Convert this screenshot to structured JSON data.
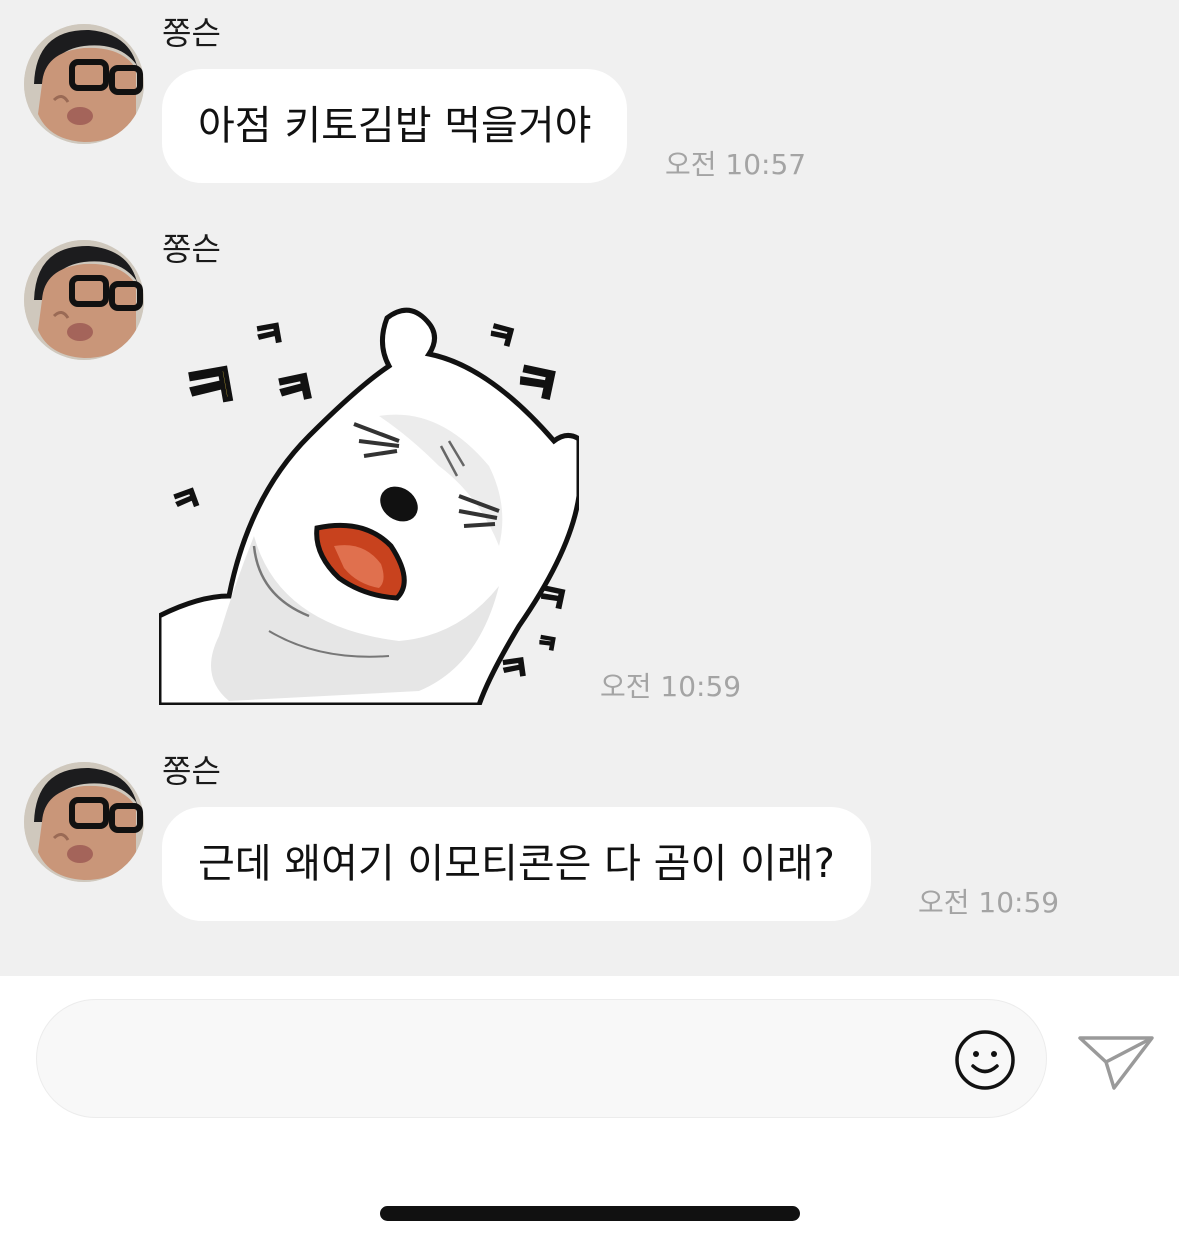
{
  "messages": [
    {
      "sender": "쫑슨",
      "type": "text",
      "text": "아점 키토김밥 먹을거야",
      "time": "오전 10:57"
    },
    {
      "sender": "쫑슨",
      "type": "sticker",
      "sticker_text": [
        "ㅋ",
        "ㅋ",
        "ㅋ",
        "ㅋ",
        "ㅋ",
        "ㅋ",
        "ㅋ",
        "ㅋ",
        "ㅋ"
      ],
      "time": "오전 10:59"
    },
    {
      "sender": "쫑슨",
      "type": "text",
      "text": "근데 왜여기 이모티콘은 다 곰이 이래?",
      "time": "오전 10:59"
    }
  ],
  "composer": {
    "value": "",
    "placeholder": ""
  },
  "icons": {
    "emoji": "smiley-icon",
    "send": "paper-plane-icon"
  },
  "colors": {
    "chat_bg": "#f0f0f0",
    "bubble_bg": "#ffffff",
    "time_text": "#a4a4a4",
    "sticker_text_yellow": "#f5d23c",
    "sticker_text_orange": "#f0a032"
  }
}
